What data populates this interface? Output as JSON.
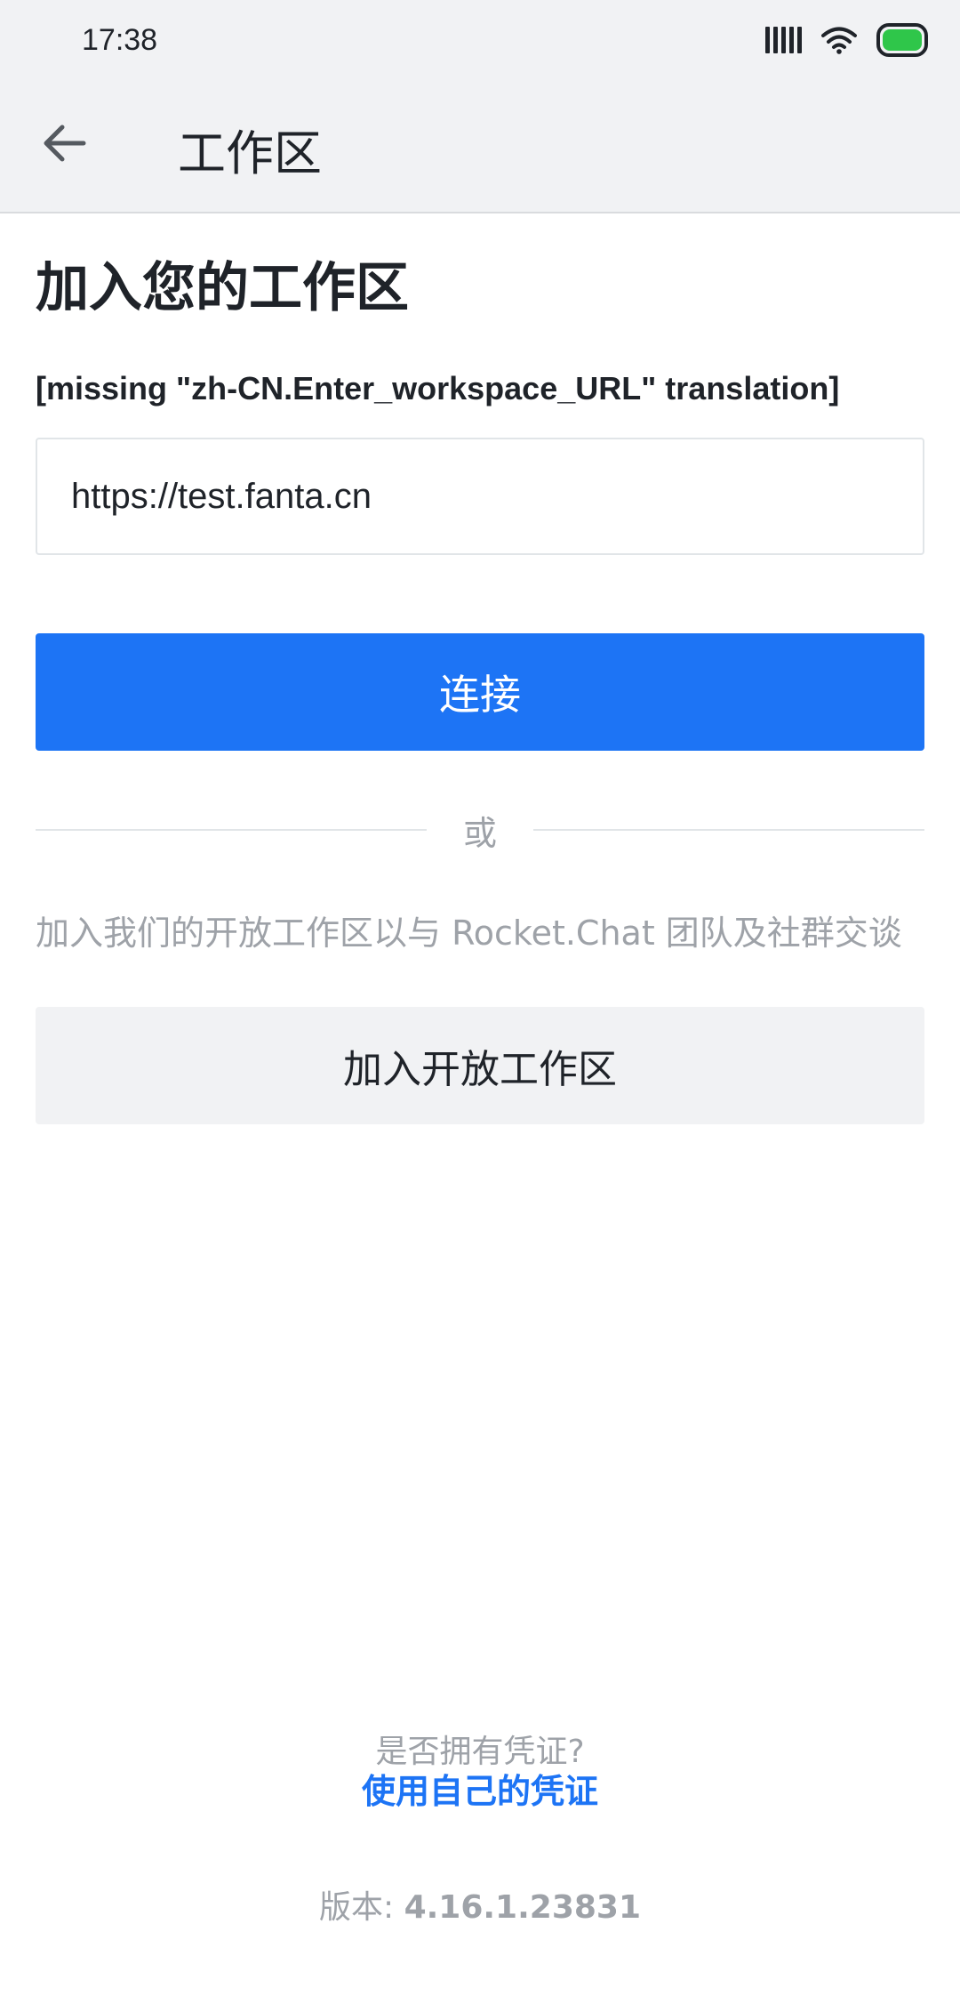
{
  "status_bar": {
    "time": "17:38",
    "icons": [
      "signal-icon",
      "wifi-icon",
      "battery-icon"
    ],
    "battery_color": "#2fc64a"
  },
  "app_bar": {
    "back_icon": "arrow-left-icon",
    "title": "工作区"
  },
  "main": {
    "title": "加入您的工作区",
    "url_label": "[missing \"zh-CN.Enter_workspace_URL\" translation]",
    "url_value": "https://test.fanta.cn",
    "connect_button": "连接",
    "or_text": "或",
    "open_workspace_info": "加入我们的开放工作区以与 Rocket.Chat 团队及社群交谈",
    "open_workspace_button": "加入开放工作区"
  },
  "footer": {
    "credentials_question": "是否拥有凭证?",
    "credentials_link": "使用自己的凭证",
    "version_label": "版本:",
    "version_number": "4.16.1.23831"
  },
  "colors": {
    "accent": "#1d74f5",
    "secondary_button_bg": "#f1f2f4",
    "muted_text": "#9ea2a8"
  }
}
